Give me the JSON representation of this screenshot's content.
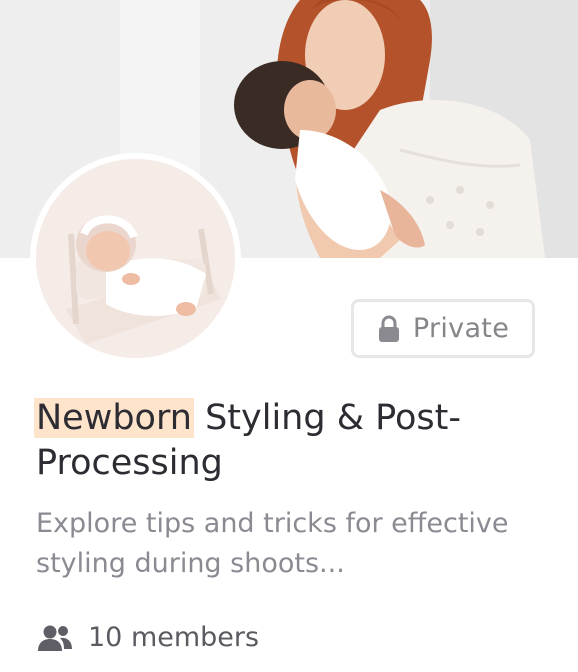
{
  "group": {
    "privacy": "Private",
    "title_highlight": "Newborn",
    "title_rest": "Styling & Post-Processing",
    "description": "Explore tips and tricks for effective styling during shoots...",
    "members": "10 members"
  },
  "icons": {
    "privacy": "lock-icon",
    "members": "people-icon"
  },
  "colors": {
    "highlight": "#fde4cb",
    "title": "#2d2c33",
    "description": "#8b8a92",
    "badge_text": "#85858a",
    "badge_border": "#e7e7e9"
  }
}
